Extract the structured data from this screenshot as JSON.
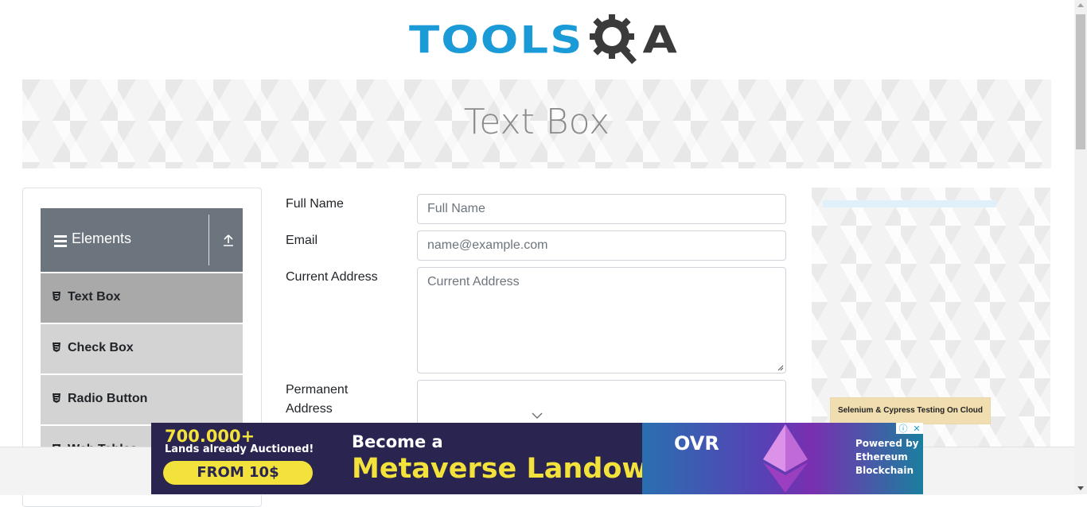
{
  "header": {
    "logo_left": "TOOLS",
    "logo_right": "A"
  },
  "banner": {
    "title": "Text Box"
  },
  "sidebar": {
    "group_title": "Elements",
    "items": [
      {
        "label": "Text Box",
        "active": true
      },
      {
        "label": "Check Box",
        "active": false
      },
      {
        "label": "Radio Button",
        "active": false
      },
      {
        "label": "Web Tables",
        "active": false
      }
    ]
  },
  "form": {
    "full_name": {
      "label": "Full Name",
      "placeholder": "Full Name",
      "value": ""
    },
    "email": {
      "label": "Email",
      "placeholder": "name@example.com",
      "value": ""
    },
    "current_address": {
      "label": "Current Address",
      "placeholder": "Current Address",
      "value": ""
    },
    "permanent_address": {
      "label_line1": "Permanent",
      "label_line2": "Address",
      "value": ""
    }
  },
  "right_ad": {
    "button_text": "Selenium & Cypress Testing On Cloud"
  },
  "bottom_ad": {
    "count": "700.000+",
    "count_sub": "Lands already Auctioned!",
    "price_button": "FROM 10$",
    "headline_1": "Become a",
    "headline_2": "Metaverse Landowner",
    "brand": "OVR",
    "powered_1": "Powered by",
    "powered_2": "Ethereum",
    "powered_3": "Blockchain",
    "colors": {
      "background": "#2a2450",
      "accent": "#f2e23b"
    }
  },
  "colors": {
    "brand_blue": "#1a9ad6",
    "sidebar_header": "#6c757d",
    "menu_active": "#a9a9a9",
    "menu_item": "#d3d3d3"
  }
}
